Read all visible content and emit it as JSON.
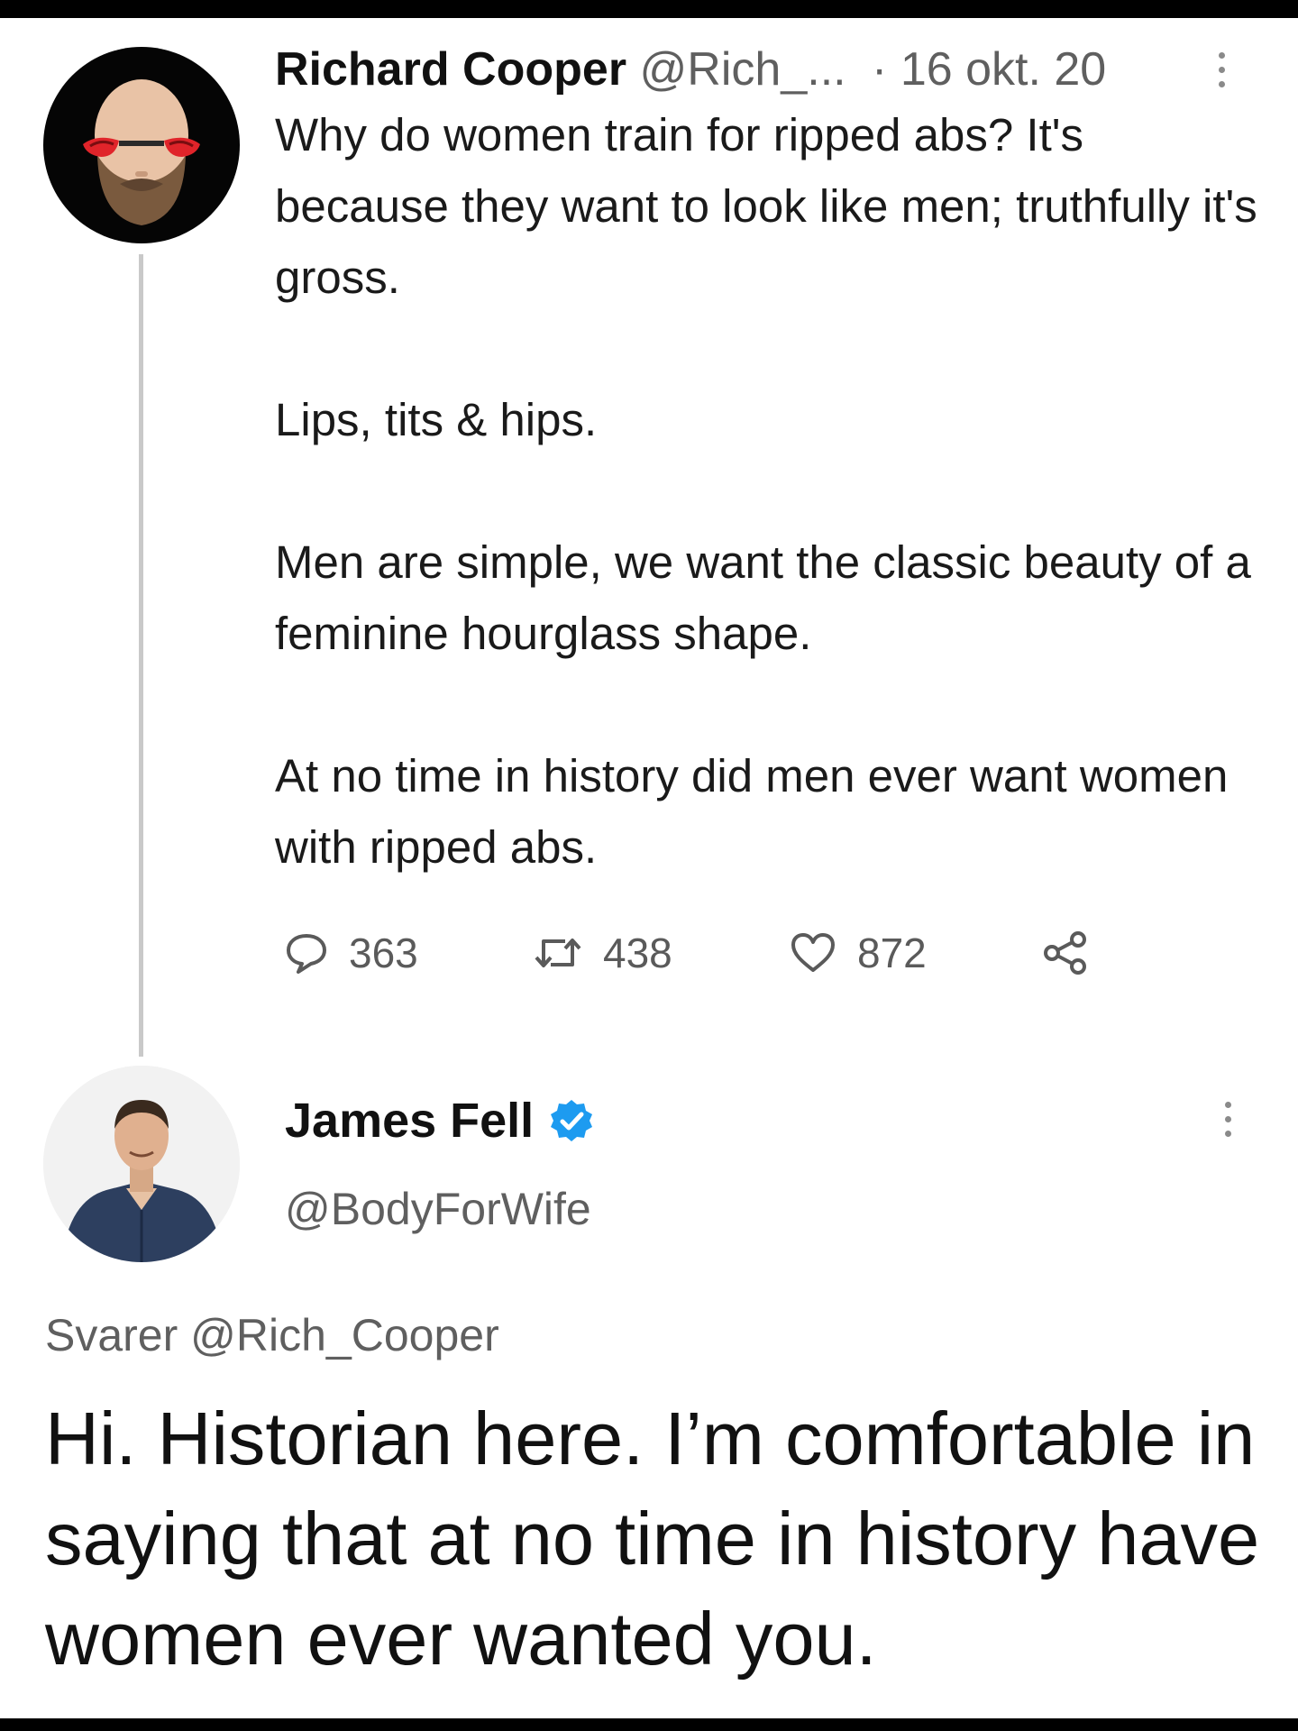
{
  "tweet1": {
    "author_name": "Richard Cooper",
    "handle": "@Rich_...",
    "separator": "·",
    "date": "16 okt. 20",
    "paragraphs": [
      "Why do women train for ripped abs? It's because they want to look like men; truthfully it's gross.",
      "Lips, tits & hips.",
      "Men are simple, we want the classic beauty of a feminine hourglass shape.",
      "At no time in history did men ever want women with ripped abs."
    ],
    "replies": "363",
    "retweets": "438",
    "likes": "872",
    "avatar_icon": "bald-bearded-man-red-glasses-icon"
  },
  "tweet2": {
    "author_name": "James Fell",
    "verified_icon": "verified-badge-icon",
    "handle": "@BodyForWife",
    "replying_to": "Svarer @Rich_Cooper",
    "body": "Hi. Historian here. I’m comfortable in saying that at no time in history have women ever wanted you.",
    "avatar_icon": "man-in-blue-shirt-icon"
  },
  "colors": {
    "verified_blue": "#1d9bf0",
    "thread_line": "#c9c9c9",
    "muted_text": "#5f5f5f",
    "avatar1_glasses": "#e0242a"
  }
}
